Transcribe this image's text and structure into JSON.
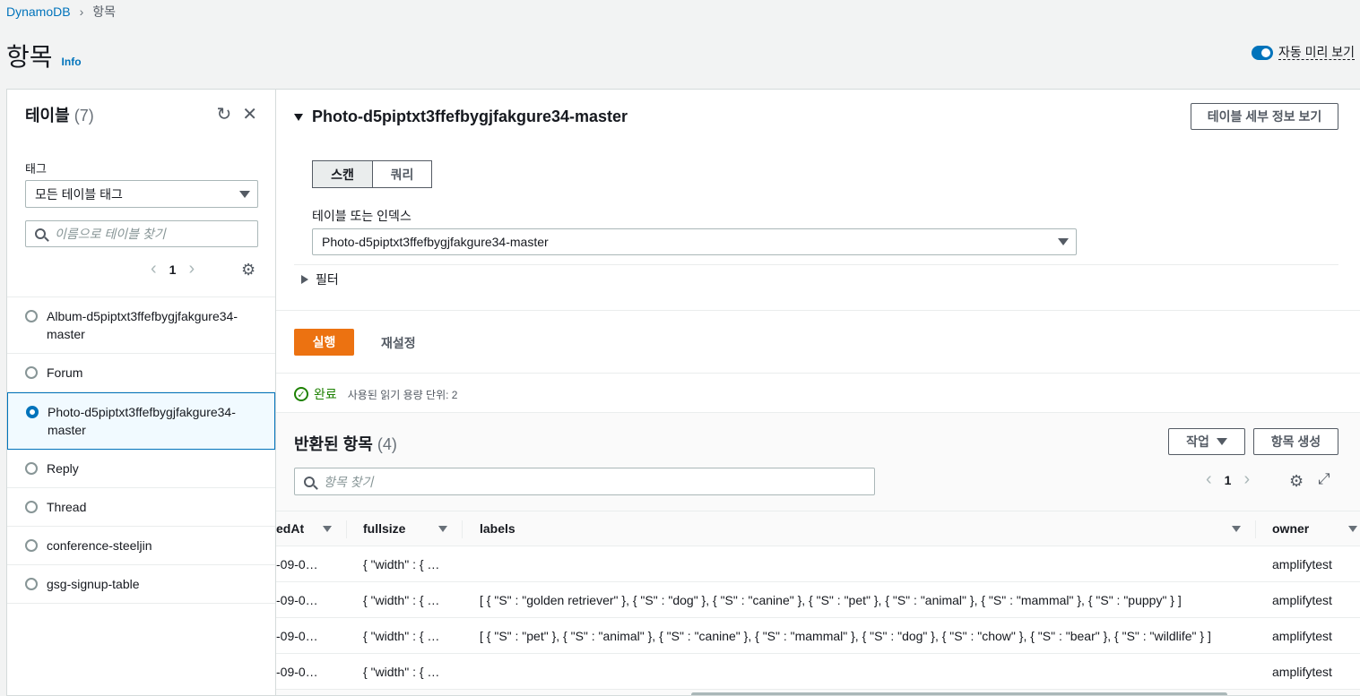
{
  "breadcrumb": {
    "root": "DynamoDB",
    "current": "항목"
  },
  "page": {
    "title": "항목",
    "info_link": "Info",
    "auto_preview_label": "자동 미리 보기"
  },
  "sidebar": {
    "title": "테이블",
    "count": "(7)",
    "tag_label": "태그",
    "tag_select_value": "모든 테이블 태그",
    "search_placeholder": "이름으로 테이블 찾기",
    "page": "1",
    "tables": [
      {
        "name": "Album-d5piptxt3ffefbygjfakgure34-master",
        "line1": "Album-d5piptxt3ffefbygjfakgure34-",
        "line2": "master"
      },
      {
        "name": "Forum",
        "line1": "Forum",
        "line2": ""
      },
      {
        "name": "Photo-d5piptxt3ffefbygjfakgure34-master",
        "line1": "Photo-d5piptxt3ffefbygjfakgure34-",
        "line2": "master"
      },
      {
        "name": "Reply",
        "line1": "Reply",
        "line2": ""
      },
      {
        "name": "Thread",
        "line1": "Thread",
        "line2": ""
      },
      {
        "name": "conference-steeljin",
        "line1": "conference-steeljin",
        "line2": ""
      },
      {
        "name": "gsg-signup-table",
        "line1": "gsg-signup-table",
        "line2": ""
      }
    ],
    "selected_index": 2
  },
  "main": {
    "table_name": "Photo-d5piptxt3ffefbygjfakgure34-master",
    "details_button": "테이블 세부 정보 보기",
    "tab_scan": "스캔",
    "tab_query": "쿼리",
    "index_label": "테이블 또는 인덱스",
    "index_value": "Photo-d5piptxt3ffefbygjfakgure34-master",
    "filter_label": "필터",
    "run_button": "실행",
    "reset_button": "재설정",
    "status_done": "완료",
    "status_rcu": "사용된 읽기 용량 단위: 2",
    "results_title": "반환된 항목",
    "results_count": "(4)",
    "actions_button": "작업",
    "create_button": "항목 생성",
    "items_search_placeholder": "항목 찾기",
    "page": "1"
  },
  "items_table": {
    "columns": [
      "edAt",
      "fullsize",
      "labels",
      "owner"
    ],
    "rows": [
      {
        "createdAt": "-09-0…",
        "fullsize": "{ \"width\" : { …",
        "labels": "",
        "owner": "amplifytest"
      },
      {
        "createdAt": "-09-0…",
        "fullsize": "{ \"width\" : { …",
        "labels": "[ { \"S\" : \"golden retriever\" }, { \"S\" : \"dog\" }, { \"S\" : \"canine\" }, { \"S\" : \"pet\" }, { \"S\" : \"animal\" }, { \"S\" : \"mammal\" }, { \"S\" : \"puppy\" } ]",
        "owner": "amplifytest"
      },
      {
        "createdAt": "-09-0…",
        "fullsize": "{ \"width\" : { …",
        "labels": "[ { \"S\" : \"pet\" }, { \"S\" : \"animal\" }, { \"S\" : \"canine\" }, { \"S\" : \"mammal\" }, { \"S\" : \"dog\" }, { \"S\" : \"chow\" }, { \"S\" : \"bear\" }, { \"S\" : \"wildlife\" } ]",
        "owner": "amplifytest"
      },
      {
        "createdAt": "-09-0…",
        "fullsize": "{ \"width\" : { …",
        "labels": "",
        "owner": "amplifytest"
      }
    ]
  },
  "colors": {
    "accent": "#0073bb",
    "primary_button": "#ec7211",
    "success": "#1d8102"
  }
}
